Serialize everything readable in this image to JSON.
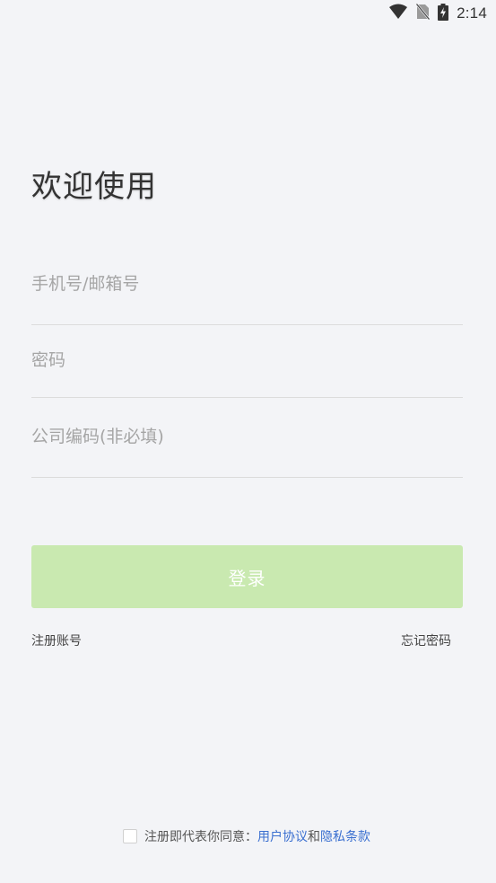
{
  "status_bar": {
    "time": "2:14",
    "icons": [
      "wifi-icon",
      "no-sim-icon",
      "battery-charging-icon"
    ]
  },
  "login": {
    "title": "欢迎使用",
    "phone_placeholder": "手机号/邮箱号",
    "password_placeholder": "密码",
    "company_placeholder": "公司编码(非必填)",
    "login_button": "登录",
    "register_link": "注册账号",
    "forgot_link": "忘记密码"
  },
  "agreement": {
    "text": "注册即代表你同意：",
    "user_agreement": "用户协议",
    "and": "和",
    "privacy_policy": "隐私条款",
    "checked": false
  },
  "colors": {
    "background": "#f3f4f7",
    "button_disabled": "#c9e9b0",
    "link": "#3a6fd0"
  }
}
